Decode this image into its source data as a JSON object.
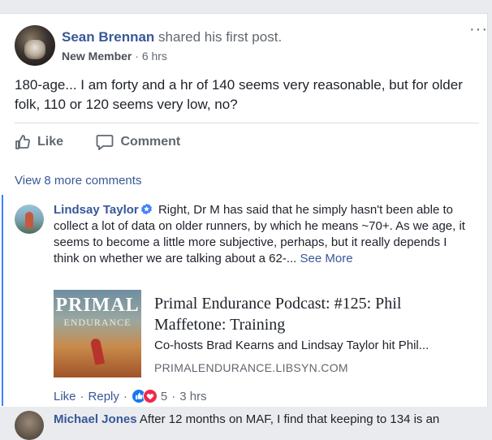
{
  "post": {
    "author": "Sean Brennan",
    "action": "shared his first post.",
    "badge": "New Member",
    "dot": "·",
    "time": "6 hrs",
    "more": "···",
    "text": "180-age... I am forty and a hr of 140 seems very reasonable, but for older folk, 110 or 120 seems very low, no?"
  },
  "actions": {
    "like": "Like",
    "comment": "Comment"
  },
  "comments": {
    "view_more": "View 8 more comments",
    "first": {
      "author": "Lindsay Taylor",
      "text": "Right, Dr M has said that he simply hasn't been able to collect a lot of data on older runners, by which he means ~70+. As we age, it seems to become a little more subjective, perhaps, but it really depends I think on whether we are talking about a 62-...",
      "see_more": "See More",
      "link": {
        "thumb_title": "PRIMAL",
        "thumb_subtitle": "ENDURANCE",
        "title": "Primal Endurance Podcast: #125: Phil Maffetone: Training",
        "description": "Co-hosts Brad Kearns and Lindsay Taylor hit Phil...",
        "domain": "PRIMALENDURANCE.LIBSYN.COM"
      },
      "like": "Like",
      "reply": "Reply",
      "reaction_count": "5",
      "time": "3 hrs",
      "sep": "·"
    },
    "second": {
      "author": "Michael Jones",
      "text": "After 12 months on MAF, I find that keeping to 134 is an"
    }
  },
  "colors": {
    "link_blue": "#385898",
    "thread_line": "#4080ff",
    "gray_text": "#606770"
  }
}
